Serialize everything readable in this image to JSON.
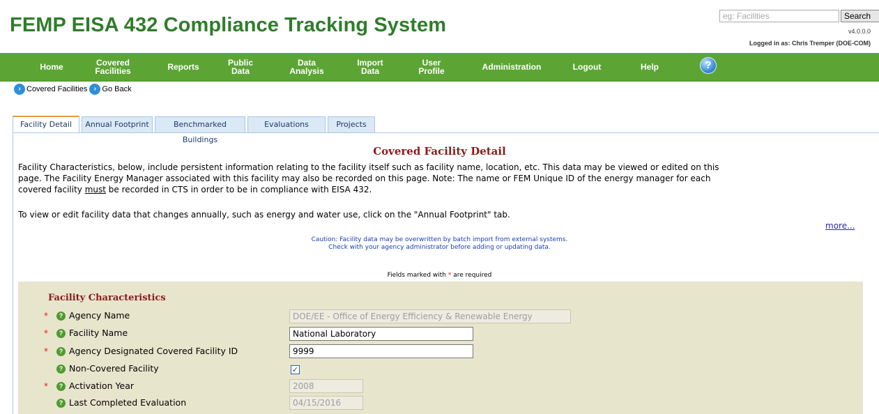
{
  "app": {
    "title": "FEMP EISA 432 Compliance Tracking System",
    "version": "v4.0.0.0",
    "logged_in": "Logged in as: Chris Tremper (DOE-COM)"
  },
  "search": {
    "placeholder": "eg: Facilities",
    "button_label": "Search"
  },
  "nav": {
    "items": [
      {
        "label": "Home"
      },
      {
        "label": "Covered\nFacilities"
      },
      {
        "label": "Reports"
      },
      {
        "label": "Public\nData"
      },
      {
        "label": "Data\nAnalysis"
      },
      {
        "label": "Import\nData"
      },
      {
        "label": "User\nProfile"
      },
      {
        "label": "Administration"
      },
      {
        "label": "Logout"
      },
      {
        "label": "Help"
      }
    ],
    "help_icon": "question-circle-icon",
    "help_glyph": "?",
    "color": "#5ca535"
  },
  "breadcrumb": {
    "items": [
      {
        "label": "Covered Facilities"
      },
      {
        "label": "Go Back"
      }
    ]
  },
  "tabs": [
    {
      "label": "Facility Detail",
      "active": true
    },
    {
      "label": "Annual Footprint",
      "active": false
    },
    {
      "label": "Benchmarked Buildings",
      "active": false
    },
    {
      "label": "Evaluations",
      "active": false
    },
    {
      "label": "Projects",
      "active": false
    }
  ],
  "page": {
    "heading": "Covered Facility Detail",
    "intro_line1": "Facility Characteristics, below, include persistent information relating to the facility itself such as facility name, location, etc.   This data may be viewed or edited on this",
    "intro_line2": "page.  The Facility Energy Manager associated with this facility may also be recorded on this page.  Note:  The name or FEM Unique ID of the energy manager for each",
    "intro_line3_pre": "covered facility ",
    "intro_line3_em": "must",
    "intro_line3_post": " be recorded in CTS in order to be in compliance with EISA 432.",
    "annual_note": "To view or edit facility data that changes annually, such as energy and water use, click on the \"Annual Footprint\" tab.",
    "more_link": "more...",
    "caution_line1": "Caution: Facility data may be overwritten by batch import from external systems.",
    "caution_line2": "Check with your agency administrator before adding or updating data.",
    "required_pre": "Fields marked with ",
    "required_star": "*",
    "required_post": " are required"
  },
  "form": {
    "heading": "Facility Characteristics",
    "rows": [
      {
        "label": "Agency Name",
        "required": true,
        "value": "DOE/EE - Office of Energy Efficiency & Renewable Energy",
        "disabled": true
      },
      {
        "label": "Facility Name",
        "required": true,
        "value": "National Laboratory",
        "disabled": false
      },
      {
        "label": "Agency Designated Covered Facility ID",
        "required": true,
        "value": "9999",
        "disabled": false
      },
      {
        "label": "Non-Covered Facility",
        "required": false,
        "checked": true
      },
      {
        "label": "Activation Year",
        "required": true,
        "value": "2008",
        "disabled": true
      },
      {
        "label": "Last Completed Evaluation",
        "required": false,
        "value": "04/15/2016",
        "disabled": true
      }
    ],
    "help_icon": "help-question-icon",
    "star": "*",
    "check_glyph": "✓"
  }
}
